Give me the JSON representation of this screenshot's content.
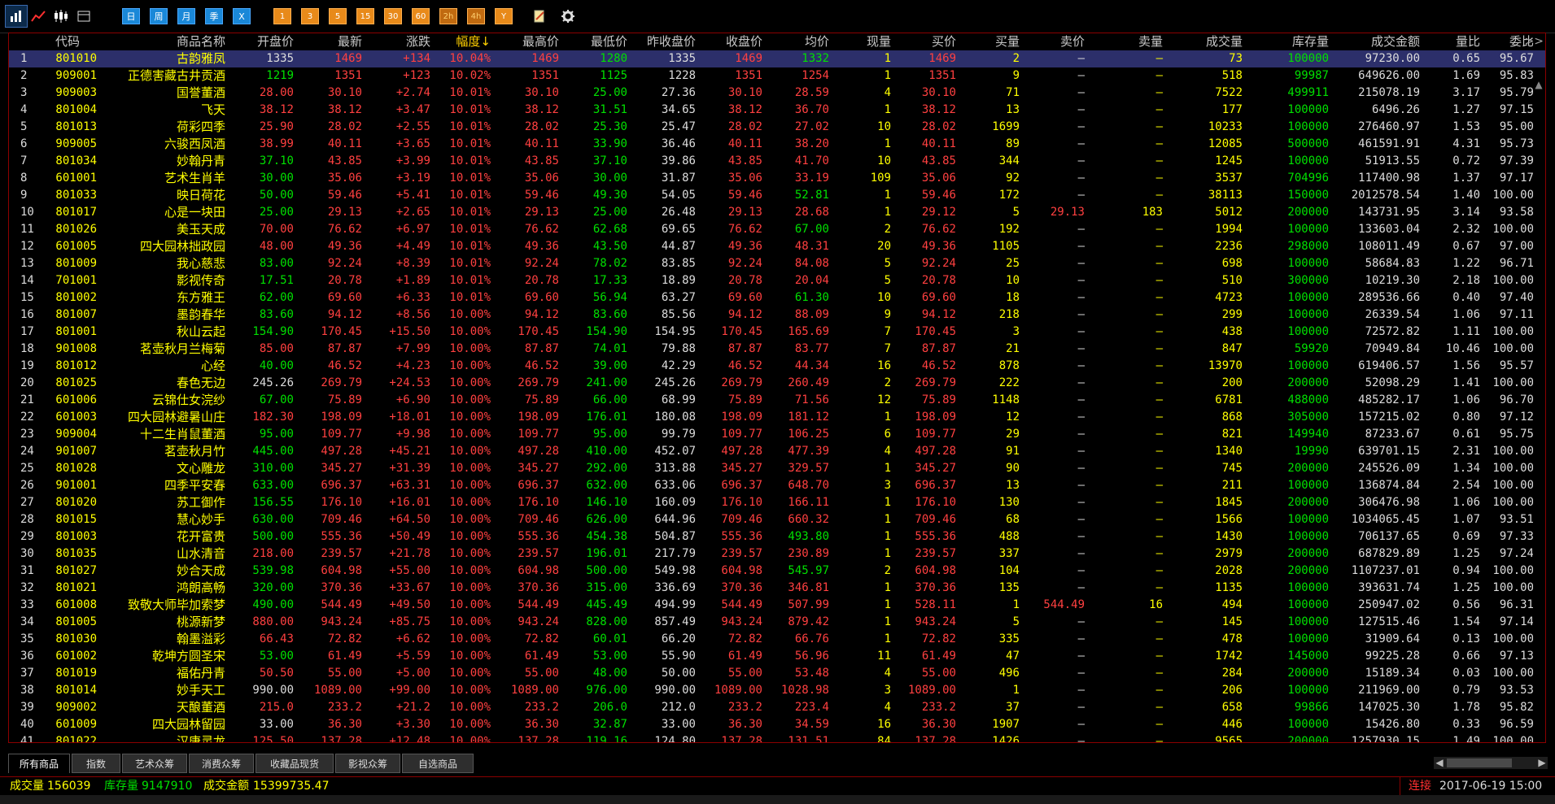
{
  "toolbar": {
    "period_buttons": [
      "日",
      "周",
      "月",
      "季",
      "X"
    ],
    "minute_buttons": [
      "1",
      "3",
      "5",
      "15",
      "30",
      "60",
      "2h",
      "4h",
      "Y"
    ]
  },
  "columns": [
    "代码",
    "商品名称",
    "开盘价",
    "最新",
    "涨跌",
    "幅度↓",
    "最高价",
    "最低价",
    "昨收盘价",
    "收盘价",
    "均价",
    "现量",
    "买价",
    "买量",
    "卖价",
    "卖量",
    "成交量",
    "库存量",
    "成交金额",
    "量比",
    "委比"
  ],
  "header_more": ">>",
  "rows": [
    [
      "801010",
      "古韵雅凤",
      "1335",
      "1469",
      "+134",
      "10.04%",
      "1469",
      "1280",
      "1335",
      "1469",
      "1332",
      "1",
      "1469",
      "2",
      "—",
      "—",
      "73",
      "100000",
      "97230.00",
      "0.65",
      "95.67"
    ],
    [
      "909001",
      "正德害藏古井贡酒",
      "1219",
      "1351",
      "+123",
      "10.02%",
      "1351",
      "1125",
      "1228",
      "1351",
      "1254",
      "1",
      "1351",
      "9",
      "—",
      "—",
      "518",
      "99987",
      "649626.00",
      "1.69",
      "95.83"
    ],
    [
      "909003",
      "国誉董酒",
      "28.00",
      "30.10",
      "+2.74",
      "10.01%",
      "30.10",
      "25.00",
      "27.36",
      "30.10",
      "28.59",
      "4",
      "30.10",
      "71",
      "—",
      "—",
      "7522",
      "499911",
      "215078.19",
      "3.17",
      "95.79"
    ],
    [
      "801004",
      "飞天",
      "38.12",
      "38.12",
      "+3.47",
      "10.01%",
      "38.12",
      "31.51",
      "34.65",
      "38.12",
      "36.70",
      "1",
      "38.12",
      "13",
      "—",
      "—",
      "177",
      "100000",
      "6496.26",
      "1.27",
      "97.15"
    ],
    [
      "801013",
      "荷彩四季",
      "25.90",
      "28.02",
      "+2.55",
      "10.01%",
      "28.02",
      "25.30",
      "25.47",
      "28.02",
      "27.02",
      "10",
      "28.02",
      "1699",
      "—",
      "—",
      "10233",
      "100000",
      "276460.97",
      "1.53",
      "95.00"
    ],
    [
      "909005",
      "六骏西凤酒",
      "38.99",
      "40.11",
      "+3.65",
      "10.01%",
      "40.11",
      "33.90",
      "36.46",
      "40.11",
      "38.20",
      "1",
      "40.11",
      "89",
      "—",
      "—",
      "12085",
      "500000",
      "461591.91",
      "4.31",
      "95.73"
    ],
    [
      "801034",
      "妙翰丹青",
      "37.10",
      "43.85",
      "+3.99",
      "10.01%",
      "43.85",
      "37.10",
      "39.86",
      "43.85",
      "41.70",
      "10",
      "43.85",
      "344",
      "—",
      "—",
      "1245",
      "100000",
      "51913.55",
      "0.72",
      "97.39"
    ],
    [
      "601001",
      "艺术生肖羊",
      "30.00",
      "35.06",
      "+3.19",
      "10.01%",
      "35.06",
      "30.00",
      "31.87",
      "35.06",
      "33.19",
      "109",
      "35.06",
      "92",
      "—",
      "—",
      "3537",
      "704996",
      "117400.98",
      "1.37",
      "97.17"
    ],
    [
      "801033",
      "映日荷花",
      "50.00",
      "59.46",
      "+5.41",
      "10.01%",
      "59.46",
      "49.30",
      "54.05",
      "59.46",
      "52.81",
      "1",
      "59.46",
      "172",
      "—",
      "—",
      "38113",
      "150000",
      "2012578.54",
      "1.40",
      "100.00"
    ],
    [
      "801017",
      "心是一块田",
      "25.00",
      "29.13",
      "+2.65",
      "10.01%",
      "29.13",
      "25.00",
      "26.48",
      "29.13",
      "28.68",
      "1",
      "29.12",
      "5",
      "29.13",
      "183",
      "5012",
      "200000",
      "143731.95",
      "3.14",
      "93.58"
    ],
    [
      "801026",
      "美玉天成",
      "70.00",
      "76.62",
      "+6.97",
      "10.01%",
      "76.62",
      "62.68",
      "69.65",
      "76.62",
      "67.00",
      "2",
      "76.62",
      "192",
      "—",
      "—",
      "1994",
      "100000",
      "133603.04",
      "2.32",
      "100.00"
    ],
    [
      "601005",
      "四大园林拙政园",
      "48.00",
      "49.36",
      "+4.49",
      "10.01%",
      "49.36",
      "43.50",
      "44.87",
      "49.36",
      "48.31",
      "20",
      "49.36",
      "1105",
      "—",
      "—",
      "2236",
      "298000",
      "108011.49",
      "0.67",
      "97.00"
    ],
    [
      "801009",
      "我心慈悲",
      "83.00",
      "92.24",
      "+8.39",
      "10.01%",
      "92.24",
      "78.02",
      "83.85",
      "92.24",
      "84.08",
      "5",
      "92.24",
      "25",
      "—",
      "—",
      "698",
      "100000",
      "58684.83",
      "1.22",
      "96.71"
    ],
    [
      "701001",
      "影视传奇",
      "17.51",
      "20.78",
      "+1.89",
      "10.01%",
      "20.78",
      "17.33",
      "18.89",
      "20.78",
      "20.04",
      "5",
      "20.78",
      "10",
      "—",
      "—",
      "510",
      "300000",
      "10219.30",
      "2.18",
      "100.00"
    ],
    [
      "801002",
      "东方雅王",
      "62.00",
      "69.60",
      "+6.33",
      "10.01%",
      "69.60",
      "56.94",
      "63.27",
      "69.60",
      "61.30",
      "10",
      "69.60",
      "18",
      "—",
      "—",
      "4723",
      "100000",
      "289536.66",
      "0.40",
      "97.40"
    ],
    [
      "801007",
      "墨韵春华",
      "83.60",
      "94.12",
      "+8.56",
      "10.00%",
      "94.12",
      "83.60",
      "85.56",
      "94.12",
      "88.09",
      "9",
      "94.12",
      "218",
      "—",
      "—",
      "299",
      "100000",
      "26339.54",
      "1.06",
      "97.11"
    ],
    [
      "801001",
      "秋山云起",
      "154.90",
      "170.45",
      "+15.50",
      "10.00%",
      "170.45",
      "154.90",
      "154.95",
      "170.45",
      "165.69",
      "7",
      "170.45",
      "3",
      "—",
      "—",
      "438",
      "100000",
      "72572.82",
      "1.11",
      "100.00"
    ],
    [
      "901008",
      "茗壶秋月兰梅菊",
      "85.00",
      "87.87",
      "+7.99",
      "10.00%",
      "87.87",
      "74.01",
      "79.88",
      "87.87",
      "83.77",
      "7",
      "87.87",
      "21",
      "—",
      "—",
      "847",
      "59920",
      "70949.84",
      "10.46",
      "100.00"
    ],
    [
      "801012",
      "心经",
      "40.00",
      "46.52",
      "+4.23",
      "10.00%",
      "46.52",
      "39.00",
      "42.29",
      "46.52",
      "44.34",
      "16",
      "46.52",
      "878",
      "—",
      "—",
      "13970",
      "100000",
      "619406.57",
      "1.56",
      "95.57"
    ],
    [
      "801025",
      "春色无边",
      "245.26",
      "269.79",
      "+24.53",
      "10.00%",
      "269.79",
      "241.00",
      "245.26",
      "269.79",
      "260.49",
      "2",
      "269.79",
      "222",
      "—",
      "—",
      "200",
      "200000",
      "52098.29",
      "1.41",
      "100.00"
    ],
    [
      "601006",
      "云锦仕女浣纱",
      "67.00",
      "75.89",
      "+6.90",
      "10.00%",
      "75.89",
      "66.00",
      "68.99",
      "75.89",
      "71.56",
      "12",
      "75.89",
      "1148",
      "—",
      "—",
      "6781",
      "488000",
      "485282.17",
      "1.06",
      "96.70"
    ],
    [
      "601003",
      "四大园林避暑山庄",
      "182.30",
      "198.09",
      "+18.01",
      "10.00%",
      "198.09",
      "176.01",
      "180.08",
      "198.09",
      "181.12",
      "1",
      "198.09",
      "12",
      "—",
      "—",
      "868",
      "305000",
      "157215.02",
      "0.80",
      "97.12"
    ],
    [
      "909004",
      "十二生肖鼠董酒",
      "95.00",
      "109.77",
      "+9.98",
      "10.00%",
      "109.77",
      "95.00",
      "99.79",
      "109.77",
      "106.25",
      "6",
      "109.77",
      "29",
      "—",
      "—",
      "821",
      "149940",
      "87233.67",
      "0.61",
      "95.75"
    ],
    [
      "901007",
      "茗壶秋月竹",
      "445.00",
      "497.28",
      "+45.21",
      "10.00%",
      "497.28",
      "410.00",
      "452.07",
      "497.28",
      "477.39",
      "4",
      "497.28",
      "91",
      "—",
      "—",
      "1340",
      "19990",
      "639701.15",
      "2.31",
      "100.00"
    ],
    [
      "801028",
      "文心雕龙",
      "310.00",
      "345.27",
      "+31.39",
      "10.00%",
      "345.27",
      "292.00",
      "313.88",
      "345.27",
      "329.57",
      "1",
      "345.27",
      "90",
      "—",
      "—",
      "745",
      "200000",
      "245526.09",
      "1.34",
      "100.00"
    ],
    [
      "901001",
      "四季平安春",
      "633.00",
      "696.37",
      "+63.31",
      "10.00%",
      "696.37",
      "632.00",
      "633.06",
      "696.37",
      "648.70",
      "3",
      "696.37",
      "13",
      "—",
      "—",
      "211",
      "100000",
      "136874.84",
      "2.54",
      "100.00"
    ],
    [
      "801020",
      "苏工御作",
      "156.55",
      "176.10",
      "+16.01",
      "10.00%",
      "176.10",
      "146.10",
      "160.09",
      "176.10",
      "166.11",
      "1",
      "176.10",
      "130",
      "—",
      "—",
      "1845",
      "200000",
      "306476.98",
      "1.06",
      "100.00"
    ],
    [
      "801015",
      "慧心妙手",
      "630.00",
      "709.46",
      "+64.50",
      "10.00%",
      "709.46",
      "626.00",
      "644.96",
      "709.46",
      "660.32",
      "1",
      "709.46",
      "68",
      "—",
      "—",
      "1566",
      "100000",
      "1034065.45",
      "1.07",
      "93.51"
    ],
    [
      "801003",
      "花开富贵",
      "500.00",
      "555.36",
      "+50.49",
      "10.00%",
      "555.36",
      "454.38",
      "504.87",
      "555.36",
      "493.80",
      "1",
      "555.36",
      "488",
      "—",
      "—",
      "1430",
      "100000",
      "706137.65",
      "0.69",
      "97.33"
    ],
    [
      "801035",
      "山水清音",
      "218.00",
      "239.57",
      "+21.78",
      "10.00%",
      "239.57",
      "196.01",
      "217.79",
      "239.57",
      "230.89",
      "1",
      "239.57",
      "337",
      "—",
      "—",
      "2979",
      "200000",
      "687829.89",
      "1.25",
      "97.24"
    ],
    [
      "801027",
      "妙合天成",
      "539.98",
      "604.98",
      "+55.00",
      "10.00%",
      "604.98",
      "500.00",
      "549.98",
      "604.98",
      "545.97",
      "2",
      "604.98",
      "104",
      "—",
      "—",
      "2028",
      "200000",
      "1107237.01",
      "0.94",
      "100.00"
    ],
    [
      "801021",
      "鸿朗高畅",
      "320.00",
      "370.36",
      "+33.67",
      "10.00%",
      "370.36",
      "315.00",
      "336.69",
      "370.36",
      "346.81",
      "1",
      "370.36",
      "135",
      "—",
      "—",
      "1135",
      "100000",
      "393631.74",
      "1.25",
      "100.00"
    ],
    [
      "601008",
      "致敬大师毕加索梦",
      "490.00",
      "544.49",
      "+49.50",
      "10.00%",
      "544.49",
      "445.49",
      "494.99",
      "544.49",
      "507.99",
      "1",
      "528.11",
      "1",
      "544.49",
      "16",
      "494",
      "100000",
      "250947.02",
      "0.56",
      "96.31"
    ],
    [
      "801005",
      "桃源新梦",
      "880.00",
      "943.24",
      "+85.75",
      "10.00%",
      "943.24",
      "828.00",
      "857.49",
      "943.24",
      "879.42",
      "1",
      "943.24",
      "5",
      "—",
      "—",
      "145",
      "100000",
      "127515.46",
      "1.54",
      "97.14"
    ],
    [
      "801030",
      "翰墨溢彩",
      "66.43",
      "72.82",
      "+6.62",
      "10.00%",
      "72.82",
      "60.01",
      "66.20",
      "72.82",
      "66.76",
      "1",
      "72.82",
      "335",
      "—",
      "—",
      "478",
      "100000",
      "31909.64",
      "0.13",
      "100.00"
    ],
    [
      "601002",
      "乾坤方圆圣宋",
      "53.00",
      "61.49",
      "+5.59",
      "10.00%",
      "61.49",
      "53.00",
      "55.90",
      "61.49",
      "56.96",
      "11",
      "61.49",
      "47",
      "—",
      "—",
      "1742",
      "145000",
      "99225.28",
      "0.66",
      "97.13"
    ],
    [
      "801019",
      "福佑丹青",
      "50.50",
      "55.00",
      "+5.00",
      "10.00%",
      "55.00",
      "48.00",
      "50.00",
      "55.00",
      "53.48",
      "4",
      "55.00",
      "496",
      "—",
      "—",
      "284",
      "200000",
      "15189.34",
      "0.03",
      "100.00"
    ],
    [
      "801014",
      "妙手天工",
      "990.00",
      "1089.00",
      "+99.00",
      "10.00%",
      "1089.00",
      "976.00",
      "990.00",
      "1089.00",
      "1028.98",
      "3",
      "1089.00",
      "1",
      "—",
      "—",
      "206",
      "100000",
      "211969.00",
      "0.79",
      "93.53"
    ],
    [
      "909002",
      "天酿董酒",
      "215.0",
      "233.2",
      "+21.2",
      "10.00%",
      "233.2",
      "206.0",
      "212.0",
      "233.2",
      "223.4",
      "4",
      "233.2",
      "37",
      "—",
      "—",
      "658",
      "99866",
      "147025.30",
      "1.78",
      "95.82"
    ],
    [
      "601009",
      "四大园林留园",
      "33.00",
      "36.30",
      "+3.30",
      "10.00%",
      "36.30",
      "32.87",
      "33.00",
      "36.30",
      "34.59",
      "16",
      "36.30",
      "1907",
      "—",
      "—",
      "446",
      "100000",
      "15426.80",
      "0.33",
      "96.59"
    ],
    [
      "801022",
      "汉唐灵龙",
      "125.50",
      "137.28",
      "+12.48",
      "10.00%",
      "137.28",
      "119.16",
      "124.80",
      "137.28",
      "131.51",
      "84",
      "137.28",
      "1426",
      "—",
      "—",
      "9565",
      "200000",
      "1257930.15",
      "1.49",
      "100.00"
    ]
  ],
  "tabs": [
    "所有商品",
    "指数",
    "艺术众筹",
    "消费众筹",
    "收藏品现货",
    "影视众筹",
    "自选商品"
  ],
  "status": {
    "volume_label": "成交量",
    "volume": "156039",
    "stock_label": "库存量",
    "stock": "9147910",
    "amount_label": "成交金额",
    "amount": "15399735.47",
    "connection": "连接",
    "datetime": "2017-06-19 15:00"
  },
  "colors": {
    "up": "#ff4040",
    "down": "#00e000",
    "flat": "#dcdcdc",
    "name": "#ffff00",
    "border": "#8b0000",
    "selected_row": "#2c2f6a"
  }
}
